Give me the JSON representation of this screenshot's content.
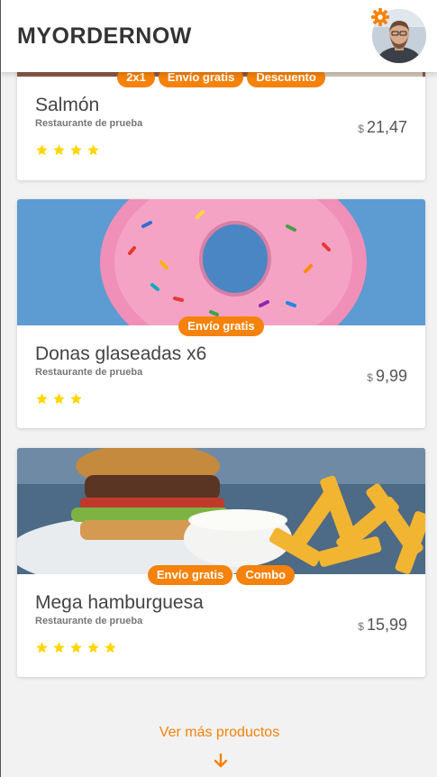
{
  "app": {
    "brand": "MYORDERNOW"
  },
  "header": {
    "avatar_icon": "user-avatar",
    "settings_icon": "gear-icon"
  },
  "colors": {
    "accent": "#f5820b",
    "star": "#ffd600"
  },
  "products": [
    {
      "name": "Salmón",
      "restaurant": "Restaurante de prueba",
      "currency": "$",
      "price": "21,47",
      "stars": 4,
      "badges": [
        "2x1",
        "Envío gratis",
        "Descuento"
      ]
    },
    {
      "name": "Donas glaseadas x6",
      "restaurant": "Restaurante de prueba",
      "currency": "$",
      "price": "9,99",
      "stars": 3,
      "badges": [
        "Envío gratis"
      ]
    },
    {
      "name": "Mega hamburguesa",
      "restaurant": "Restaurante de prueba",
      "currency": "$",
      "price": "15,99",
      "stars": 5,
      "badges": [
        "Envío gratis",
        "Combo"
      ]
    }
  ],
  "footer": {
    "more_label": "Ver más productos",
    "more_icon": "arrow-down-icon"
  }
}
